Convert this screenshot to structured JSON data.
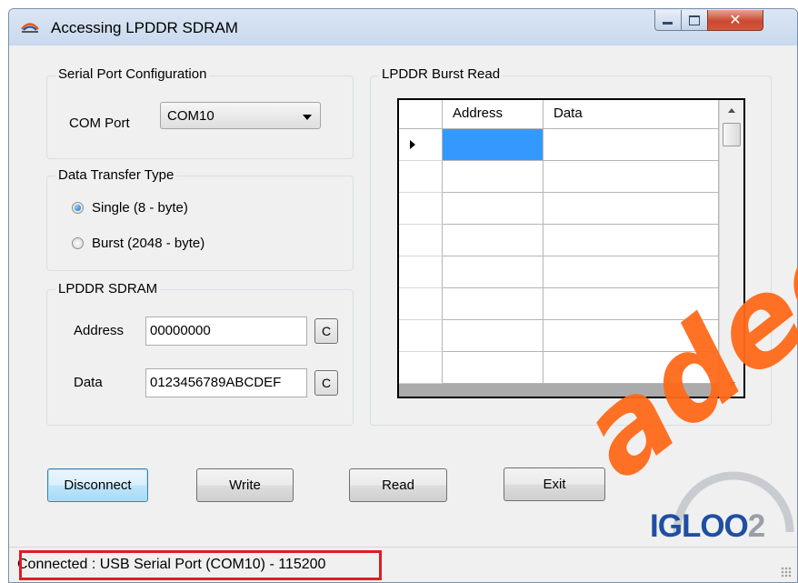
{
  "window": {
    "title": "Accessing LPDDR SDRAM"
  },
  "serial_port": {
    "group_label": "Serial Port Configuration",
    "com_label": "COM Port",
    "com_value": "COM10"
  },
  "transfer": {
    "group_label": "Data Transfer Type",
    "options": [
      {
        "label": "Single (8 - byte)",
        "checked": true
      },
      {
        "label": "Burst (2048 - byte)",
        "checked": false
      }
    ]
  },
  "sdram": {
    "group_label": "LPDDR SDRAM",
    "address_label": "Address",
    "address_value": "00000000",
    "data_label": "Data",
    "data_value": "0123456789ABCDEF",
    "clear_label": "C"
  },
  "burst": {
    "group_label": "LPDDR Burst Read",
    "columns": [
      "Address",
      "Data"
    ],
    "row_count": 8
  },
  "buttons": {
    "disconnect": "Disconnect",
    "write": "Write",
    "read": "Read",
    "exit": "Exit"
  },
  "logo": {
    "part1": "IGLOO",
    "part2": "2"
  },
  "status": {
    "text": "Connected : USB Serial Port (COM10) - 115200"
  },
  "watermark": "adeo",
  "colors": {
    "selection": "#3399ff",
    "status_highlight": "#e21b24",
    "logo_blue": "#1f4fa3",
    "watermark": "#ff6a1a"
  }
}
